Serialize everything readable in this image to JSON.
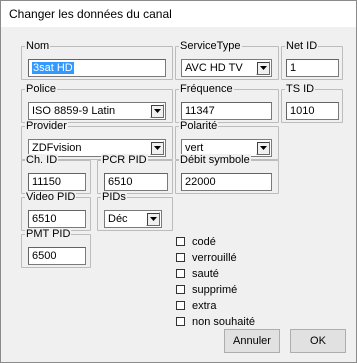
{
  "window": {
    "title": "Changer les données du canal"
  },
  "fields": {
    "nom": {
      "label": "Nom",
      "value": "3sat HD"
    },
    "service_type": {
      "label": "ServiceType",
      "value": "AVC HD TV"
    },
    "net_id": {
      "label": "Net ID",
      "value": "1"
    },
    "police": {
      "label": "Police",
      "value": "ISO 8859-9 Latin"
    },
    "frequence": {
      "label": "Fréquence",
      "value": "11347"
    },
    "ts_id": {
      "label": "TS ID",
      "value": "1010"
    },
    "provider": {
      "label": "Provider",
      "value": "ZDFvision"
    },
    "polarite": {
      "label": "Polarité",
      "value": "vert"
    },
    "ch_id": {
      "label": "Ch. ID",
      "value": "11150"
    },
    "pcr_pid": {
      "label": "PCR PID",
      "value": "6510"
    },
    "debit_symbole": {
      "label": "Débit symbole",
      "value": "22000"
    },
    "video_pid": {
      "label": "Video PID",
      "value": "6510"
    },
    "pids": {
      "label": "PIDs",
      "value": "Déc"
    },
    "pmt_pid": {
      "label": "PMT PID",
      "value": "6500"
    }
  },
  "checkboxes": [
    {
      "label": "codé",
      "checked": false
    },
    {
      "label": "verrouillé",
      "checked": false
    },
    {
      "label": "sauté",
      "checked": false
    },
    {
      "label": "supprimé",
      "checked": false
    },
    {
      "label": "extra",
      "checked": false
    },
    {
      "label": "non souhaité",
      "checked": false
    }
  ],
  "buttons": {
    "annuler": "Annuler",
    "ok": "OK"
  },
  "colors": {
    "selection": "#3399ff",
    "dialog_bg": "#f0f0f0"
  }
}
